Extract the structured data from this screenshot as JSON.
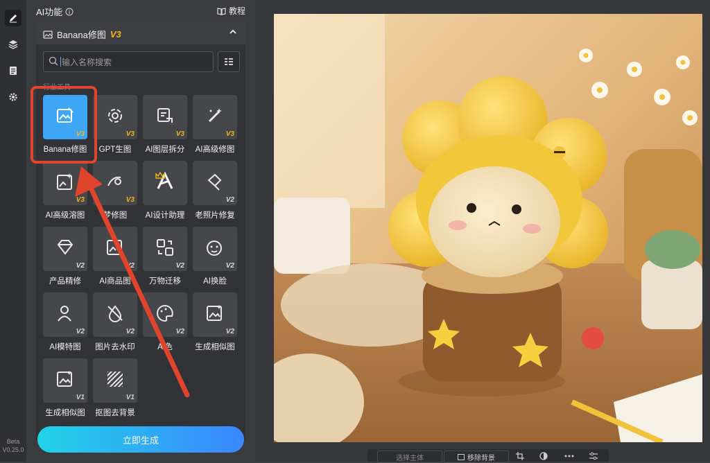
{
  "sidebar": {
    "version": [
      "Beta",
      "V0.25.0"
    ]
  },
  "panel": {
    "title": "AI功能",
    "help_label": "教程",
    "subpanel": {
      "title": "Banana修图",
      "badge": "V3",
      "search_placeholder": "输入名称搜索",
      "category": "行业工具"
    },
    "tools": [
      {
        "label": "Banana修图",
        "badge": "V3",
        "icon": "image-edit-icon"
      },
      {
        "label": "GPT生图",
        "badge": "V3",
        "icon": "openai-icon"
      },
      {
        "label": "AI图层拆分",
        "badge": "V3",
        "icon": "layer-split-icon"
      },
      {
        "label": "AI高级修图",
        "badge": "V3",
        "icon": "magic-wand-icon"
      },
      {
        "label": "AI高级溶图",
        "badge": "V3",
        "icon": "image-blend-icon"
      },
      {
        "label": "梦修图",
        "badge": "V3",
        "icon": "dream-icon"
      },
      {
        "label": "AI设计助理",
        "badge": "",
        "icon": "design-assistant-icon"
      },
      {
        "label": "老照片修复",
        "badge": "V2",
        "icon": "photo-restore-icon"
      },
      {
        "label": "产品精修",
        "badge": "V2",
        "icon": "diamond-icon"
      },
      {
        "label": "AI商品图",
        "badge": "V2",
        "icon": "product-image-icon"
      },
      {
        "label": "万物迁移",
        "badge": "V2",
        "icon": "transfer-icon"
      },
      {
        "label": "AI换脸",
        "badge": "V2",
        "icon": "face-icon"
      },
      {
        "label": "AI模特图",
        "badge": "V2",
        "icon": "model-icon"
      },
      {
        "label": "图片去水印",
        "badge": "V2",
        "icon": "remove-watermark-icon"
      },
      {
        "label": "A 色",
        "badge": "V2",
        "icon": "palette-icon"
      },
      {
        "label": "生成相似图",
        "badge": "V2",
        "icon": "similar-image-icon"
      },
      {
        "label": "生成相似图",
        "badge": "V1",
        "icon": "similar-image-icon"
      },
      {
        "label": "抠图去背景",
        "badge": "V1",
        "icon": "remove-bg-icon"
      }
    ],
    "generate_label": "立即生成"
  },
  "canvas": {
    "bottom_bar": {
      "select_label": "选择主体",
      "remove_bg_label": "移除背景"
    }
  },
  "colors": {
    "accent": "#3da6f5",
    "badge_v3": "#f2b417",
    "annotation": "#e0442d"
  }
}
